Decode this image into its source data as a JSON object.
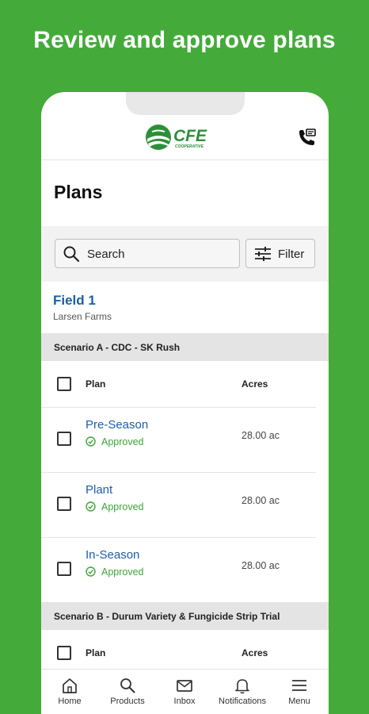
{
  "headline": "Review and approve plans",
  "app": {
    "logo_text": "CFE",
    "logo_subtext": "COOPERATIVE"
  },
  "page": {
    "title": "Plans"
  },
  "search": {
    "placeholder": "Search",
    "filter_label": "Filter"
  },
  "field": {
    "name": "Field 1",
    "farm": "Larsen Farms"
  },
  "scenarios": [
    {
      "label": "Scenario A - CDC - SK Rush",
      "columns": {
        "plan": "Plan",
        "acres": "Acres"
      },
      "plans": [
        {
          "name": "Pre-Season",
          "status": "Approved",
          "acres": "28.00 ac"
        },
        {
          "name": "Plant",
          "status": "Approved",
          "acres": "28.00 ac"
        },
        {
          "name": "In-Season",
          "status": "Approved",
          "acres": "28.00 ac"
        }
      ]
    },
    {
      "label": "Scenario B - Durum Variety & Fungicide Strip Trial",
      "columns": {
        "plan": "Plan",
        "acres": "Acres"
      },
      "plans": []
    }
  ],
  "nav": [
    {
      "label": "Home",
      "icon": "home-icon"
    },
    {
      "label": "Products",
      "icon": "search-icon"
    },
    {
      "label": "Inbox",
      "icon": "mail-icon"
    },
    {
      "label": "Notifications",
      "icon": "bell-icon"
    },
    {
      "label": "Menu",
      "icon": "menu-icon"
    }
  ],
  "colors": {
    "background": "#44ab3b",
    "link": "#1b5fa8",
    "approved": "#3fa53a",
    "brand_green": "#2e8f3a"
  }
}
